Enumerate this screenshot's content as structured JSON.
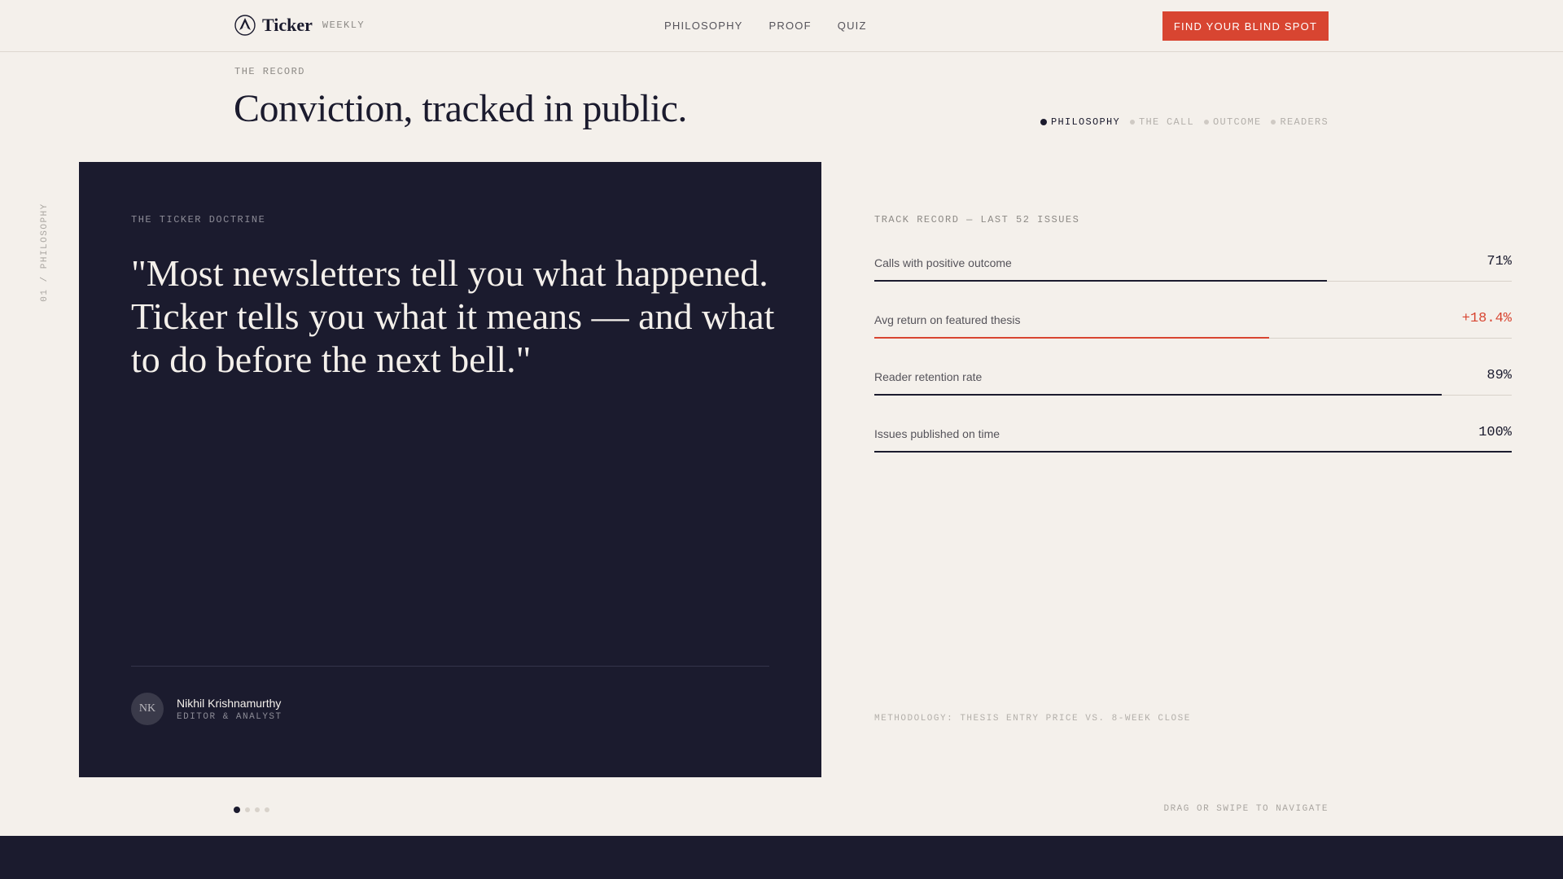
{
  "brand": {
    "name": "Ticker",
    "sub": "WEEKLY"
  },
  "nav": [
    {
      "label": "PHILOSOPHY"
    },
    {
      "label": "PROOF"
    },
    {
      "label": "QUIZ"
    }
  ],
  "cta": {
    "label": "FIND YOUR BLIND SPOT"
  },
  "section": {
    "eyebrow": "THE RECORD",
    "headline": "Conviction, tracked in public.",
    "vertical_label": "01 / PHILOSOPHY"
  },
  "steps": [
    {
      "label": "PHILOSOPHY",
      "active": true
    },
    {
      "label": "THE CALL",
      "active": false
    },
    {
      "label": "OUTCOME",
      "active": false
    },
    {
      "label": "READERS",
      "active": false
    }
  ],
  "card": {
    "eyebrow": "THE TICKER DOCTRINE",
    "quote": "\"Most newsletters tell you what happened. Ticker tells you what it means — and what to do before the next bell.\"",
    "author": {
      "initials": "NK",
      "name": "Nikhil Krishnamurthy",
      "role": "EDITOR & ANALYST"
    }
  },
  "stats": {
    "eyebrow": "TRACK RECORD — LAST 52 ISSUES",
    "items": [
      {
        "label": "Calls with positive outcome",
        "value": "71%",
        "fill": 0.71,
        "accent": false
      },
      {
        "label": "Avg return on featured thesis",
        "value": "+18.4%",
        "fill": 0.62,
        "accent": true
      },
      {
        "label": "Reader retention rate",
        "value": "89%",
        "fill": 0.89,
        "accent": false
      },
      {
        "label": "Issues published on time",
        "value": "100%",
        "fill": 1.0,
        "accent": false
      }
    ],
    "methodology": "METHODOLOGY: THESIS ENTRY PRICE VS. 8-WEEK CLOSE"
  },
  "pager": {
    "count": 4,
    "active_index": 0
  },
  "hint": "DRAG OR SWIPE TO NAVIGATE",
  "colors": {
    "ink": "#1b1b2e",
    "paper": "#f4f0eb",
    "accent": "#d84531"
  }
}
